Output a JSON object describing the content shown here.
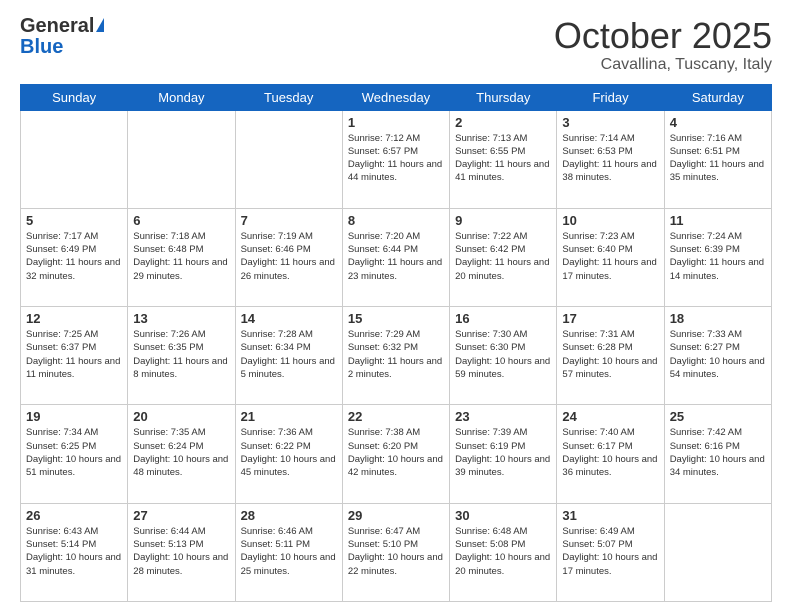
{
  "header": {
    "logo_general": "General",
    "logo_blue": "Blue",
    "title": "October 2025",
    "location": "Cavallina, Tuscany, Italy"
  },
  "weekdays": [
    "Sunday",
    "Monday",
    "Tuesday",
    "Wednesday",
    "Thursday",
    "Friday",
    "Saturday"
  ],
  "weeks": [
    [
      {
        "day": "",
        "info": ""
      },
      {
        "day": "",
        "info": ""
      },
      {
        "day": "",
        "info": ""
      },
      {
        "day": "1",
        "info": "Sunrise: 7:12 AM\nSunset: 6:57 PM\nDaylight: 11 hours and 44 minutes."
      },
      {
        "day": "2",
        "info": "Sunrise: 7:13 AM\nSunset: 6:55 PM\nDaylight: 11 hours and 41 minutes."
      },
      {
        "day": "3",
        "info": "Sunrise: 7:14 AM\nSunset: 6:53 PM\nDaylight: 11 hours and 38 minutes."
      },
      {
        "day": "4",
        "info": "Sunrise: 7:16 AM\nSunset: 6:51 PM\nDaylight: 11 hours and 35 minutes."
      }
    ],
    [
      {
        "day": "5",
        "info": "Sunrise: 7:17 AM\nSunset: 6:49 PM\nDaylight: 11 hours and 32 minutes."
      },
      {
        "day": "6",
        "info": "Sunrise: 7:18 AM\nSunset: 6:48 PM\nDaylight: 11 hours and 29 minutes."
      },
      {
        "day": "7",
        "info": "Sunrise: 7:19 AM\nSunset: 6:46 PM\nDaylight: 11 hours and 26 minutes."
      },
      {
        "day": "8",
        "info": "Sunrise: 7:20 AM\nSunset: 6:44 PM\nDaylight: 11 hours and 23 minutes."
      },
      {
        "day": "9",
        "info": "Sunrise: 7:22 AM\nSunset: 6:42 PM\nDaylight: 11 hours and 20 minutes."
      },
      {
        "day": "10",
        "info": "Sunrise: 7:23 AM\nSunset: 6:40 PM\nDaylight: 11 hours and 17 minutes."
      },
      {
        "day": "11",
        "info": "Sunrise: 7:24 AM\nSunset: 6:39 PM\nDaylight: 11 hours and 14 minutes."
      }
    ],
    [
      {
        "day": "12",
        "info": "Sunrise: 7:25 AM\nSunset: 6:37 PM\nDaylight: 11 hours and 11 minutes."
      },
      {
        "day": "13",
        "info": "Sunrise: 7:26 AM\nSunset: 6:35 PM\nDaylight: 11 hours and 8 minutes."
      },
      {
        "day": "14",
        "info": "Sunrise: 7:28 AM\nSunset: 6:34 PM\nDaylight: 11 hours and 5 minutes."
      },
      {
        "day": "15",
        "info": "Sunrise: 7:29 AM\nSunset: 6:32 PM\nDaylight: 11 hours and 2 minutes."
      },
      {
        "day": "16",
        "info": "Sunrise: 7:30 AM\nSunset: 6:30 PM\nDaylight: 10 hours and 59 minutes."
      },
      {
        "day": "17",
        "info": "Sunrise: 7:31 AM\nSunset: 6:28 PM\nDaylight: 10 hours and 57 minutes."
      },
      {
        "day": "18",
        "info": "Sunrise: 7:33 AM\nSunset: 6:27 PM\nDaylight: 10 hours and 54 minutes."
      }
    ],
    [
      {
        "day": "19",
        "info": "Sunrise: 7:34 AM\nSunset: 6:25 PM\nDaylight: 10 hours and 51 minutes."
      },
      {
        "day": "20",
        "info": "Sunrise: 7:35 AM\nSunset: 6:24 PM\nDaylight: 10 hours and 48 minutes."
      },
      {
        "day": "21",
        "info": "Sunrise: 7:36 AM\nSunset: 6:22 PM\nDaylight: 10 hours and 45 minutes."
      },
      {
        "day": "22",
        "info": "Sunrise: 7:38 AM\nSunset: 6:20 PM\nDaylight: 10 hours and 42 minutes."
      },
      {
        "day": "23",
        "info": "Sunrise: 7:39 AM\nSunset: 6:19 PM\nDaylight: 10 hours and 39 minutes."
      },
      {
        "day": "24",
        "info": "Sunrise: 7:40 AM\nSunset: 6:17 PM\nDaylight: 10 hours and 36 minutes."
      },
      {
        "day": "25",
        "info": "Sunrise: 7:42 AM\nSunset: 6:16 PM\nDaylight: 10 hours and 34 minutes."
      }
    ],
    [
      {
        "day": "26",
        "info": "Sunrise: 6:43 AM\nSunset: 5:14 PM\nDaylight: 10 hours and 31 minutes."
      },
      {
        "day": "27",
        "info": "Sunrise: 6:44 AM\nSunset: 5:13 PM\nDaylight: 10 hours and 28 minutes."
      },
      {
        "day": "28",
        "info": "Sunrise: 6:46 AM\nSunset: 5:11 PM\nDaylight: 10 hours and 25 minutes."
      },
      {
        "day": "29",
        "info": "Sunrise: 6:47 AM\nSunset: 5:10 PM\nDaylight: 10 hours and 22 minutes."
      },
      {
        "day": "30",
        "info": "Sunrise: 6:48 AM\nSunset: 5:08 PM\nDaylight: 10 hours and 20 minutes."
      },
      {
        "day": "31",
        "info": "Sunrise: 6:49 AM\nSunset: 5:07 PM\nDaylight: 10 hours and 17 minutes."
      },
      {
        "day": "",
        "info": ""
      }
    ]
  ]
}
